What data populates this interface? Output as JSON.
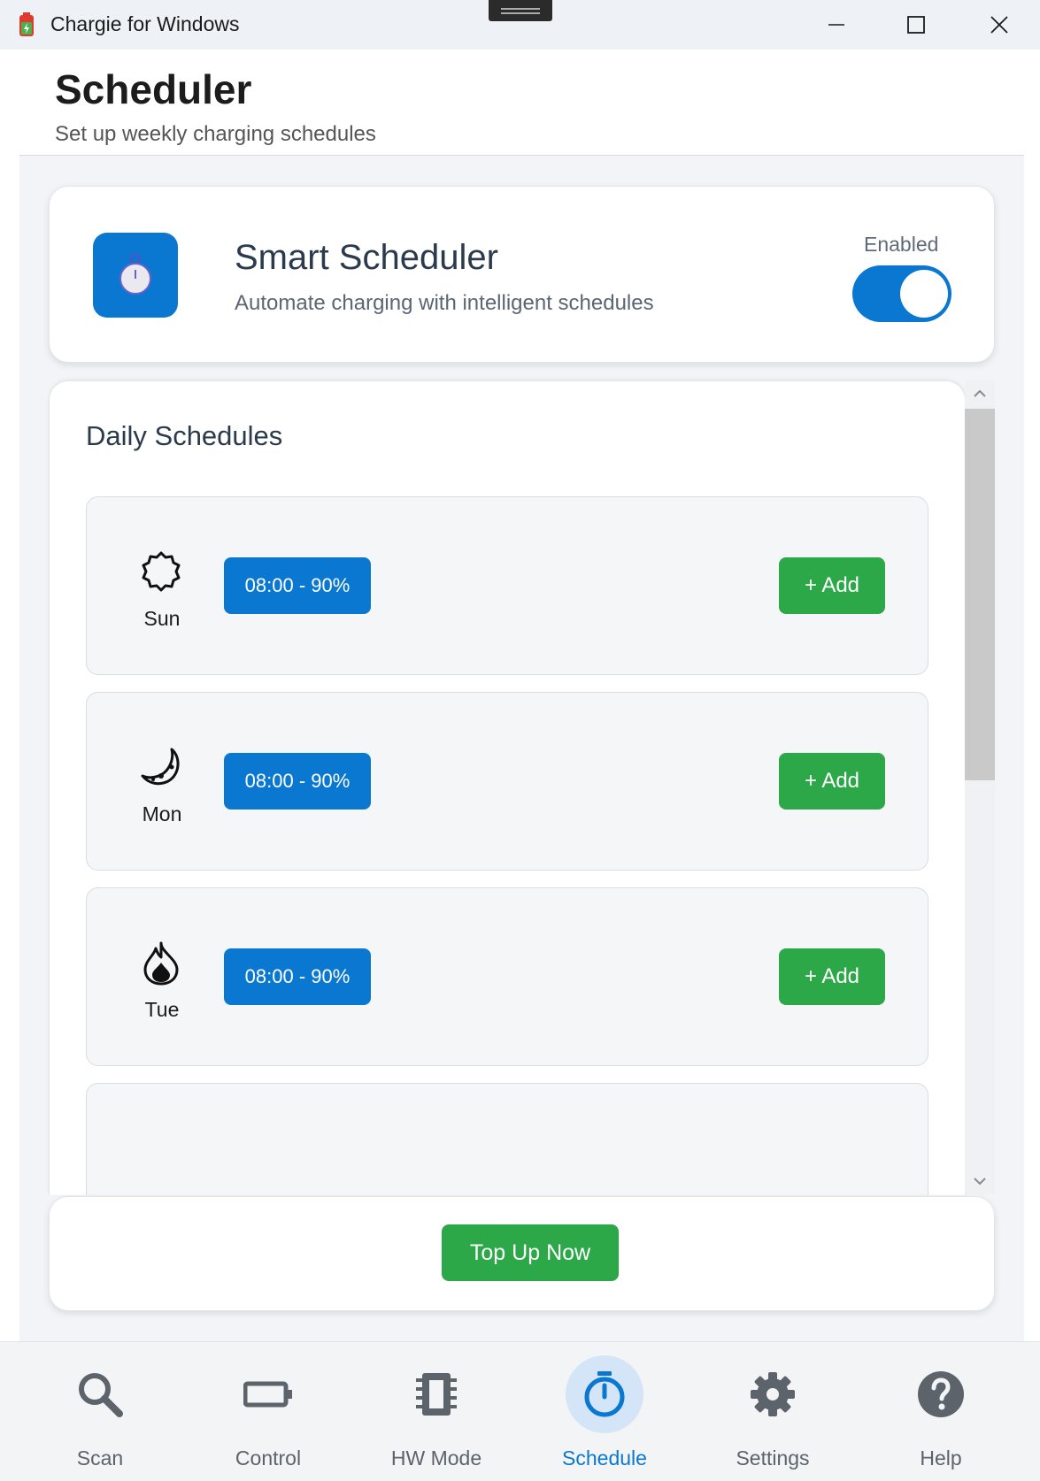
{
  "window": {
    "title": "Chargie for Windows"
  },
  "header": {
    "title": "Scheduler",
    "subtitle": "Set up weekly charging schedules"
  },
  "smart_scheduler": {
    "title": "Smart Scheduler",
    "subtitle": "Automate charging with intelligent schedules",
    "status_label": "Enabled",
    "enabled": true,
    "accent_color": "#0a78d0"
  },
  "daily": {
    "title": "Daily Schedules",
    "days": [
      {
        "label": "Sun",
        "icon": "sun-icon",
        "slot": "08:00 - 90%",
        "add_label": "+ Add"
      },
      {
        "label": "Mon",
        "icon": "moon-icon",
        "slot": "08:00 - 90%",
        "add_label": "+ Add"
      },
      {
        "label": "Tue",
        "icon": "fire-icon",
        "slot": "08:00 - 90%",
        "add_label": "+ Add"
      }
    ]
  },
  "topup": {
    "button_label": "Top Up Now",
    "color": "#2da849"
  },
  "nav": {
    "items": [
      {
        "label": "Scan",
        "icon": "search-icon"
      },
      {
        "label": "Control",
        "icon": "battery-icon"
      },
      {
        "label": "HW Mode",
        "icon": "chip-icon"
      },
      {
        "label": "Schedule",
        "icon": "stopwatch-icon",
        "active": true
      },
      {
        "label": "Settings",
        "icon": "gear-icon"
      },
      {
        "label": "Help",
        "icon": "help-icon"
      }
    ]
  }
}
